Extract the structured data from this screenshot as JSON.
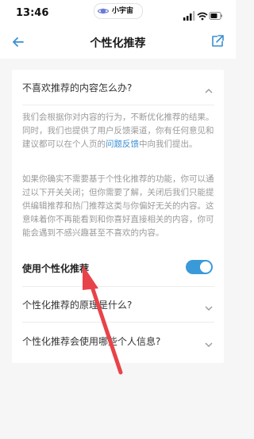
{
  "status_bar": {
    "time": "13:46",
    "pill_label": "小宇宙"
  },
  "nav": {
    "title": "个性化推荐"
  },
  "faq": [
    {
      "question": "不喜欢推荐的内容怎么办?",
      "expanded": true,
      "answer_p1_before_link": "我们会根据你对内容的行为，不断优化推荐的结果。同时，我们也提供了用户反馈渠道，你有任何意见和建议都可以在个人页的",
      "answer_p1_link": "问题反馈",
      "answer_p1_after_link": "中向我们提出。",
      "answer_p2": "如果你确实不需要基于个性化推荐的功能，你可以通过以下开关关闭；但你需要了解，关闭后我们只能提供编辑推荐和热门推荐这类与你偏好无关的内容。这意味着你不再能看到和你喜好直接相关的内容，你可能会遇到不感兴趣甚至不喜欢的内容。",
      "toggle_label": "使用个性化推荐",
      "toggle_on": true
    },
    {
      "question": "个性化推荐的原理是什么?",
      "expanded": false
    },
    {
      "question": "个性化推荐会使用哪些个人信息?",
      "expanded": false
    }
  ],
  "colors": {
    "accent": "#3a9ad9",
    "link": "#3a8fd1",
    "annotation_arrow": "#e8434a"
  }
}
